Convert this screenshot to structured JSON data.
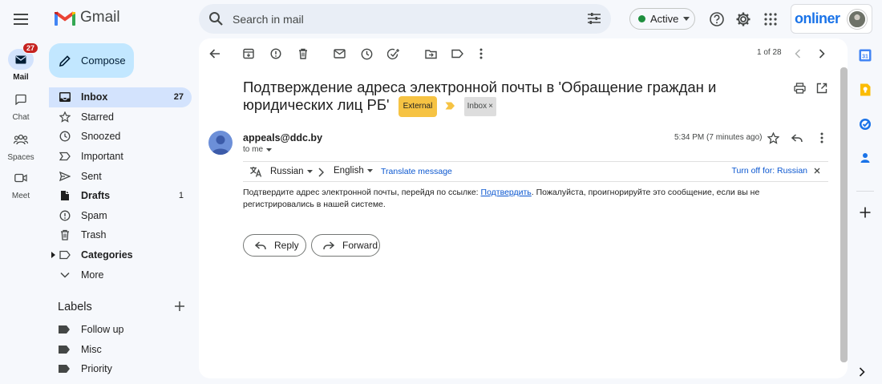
{
  "app": {
    "name": "Gmail"
  },
  "rail": {
    "items": [
      {
        "label": "Mail",
        "badge": "27",
        "icon": "mail-icon",
        "active": true
      },
      {
        "label": "Chat",
        "icon": "chat-icon"
      },
      {
        "label": "Spaces",
        "icon": "spaces-icon"
      },
      {
        "label": "Meet",
        "icon": "meet-icon"
      }
    ]
  },
  "search": {
    "placeholder": "Search in mail"
  },
  "status": {
    "label": "Active",
    "color": "#1e8e3e"
  },
  "account": {
    "brand": "onliner"
  },
  "compose": {
    "label": "Compose"
  },
  "nav": {
    "items": [
      {
        "label": "Inbox",
        "count": "27",
        "icon": "inbox-icon"
      },
      {
        "label": "Starred",
        "count": "",
        "icon": "star-icon"
      },
      {
        "label": "Snoozed",
        "count": "",
        "icon": "clock-icon"
      },
      {
        "label": "Important",
        "count": "",
        "icon": "important-icon"
      },
      {
        "label": "Sent",
        "count": "",
        "icon": "send-icon"
      },
      {
        "label": "Drafts",
        "count": "1",
        "icon": "draft-icon"
      },
      {
        "label": "Spam",
        "count": "",
        "icon": "spam-icon"
      },
      {
        "label": "Trash",
        "count": "",
        "icon": "trash-icon"
      },
      {
        "label": "Categories",
        "count": "",
        "icon": "label-icon"
      },
      {
        "label": "More",
        "count": "",
        "icon": "chevron-down-icon"
      }
    ]
  },
  "labels": {
    "header": "Labels",
    "items": [
      {
        "label": "Follow up"
      },
      {
        "label": "Misc"
      },
      {
        "label": "Priority"
      }
    ]
  },
  "toolbar": {
    "pager": "1 of 28"
  },
  "message": {
    "subject": "Подтверждение адреса электронной почты в 'Обращение граждан и юридических лиц РБ'",
    "chips": {
      "external": "External",
      "inbox": "Inbox"
    },
    "sender": "appeals@ddc.by",
    "to": "to me",
    "time": "5:34 PM (7 minutes ago)",
    "translate": {
      "from": "Russian",
      "to": "English",
      "action": "Translate message",
      "turn_off": "Turn off for: Russian"
    },
    "body": {
      "before": "Подтвердите адрес электронной почты, перейдя по ссылке: ",
      "link": "Подтвердить",
      "after": ". Пожалуйста, проигнорируйте это сообщение, если вы не регистрировались в нашей системе."
    },
    "actions": {
      "reply": "Reply",
      "forward": "Forward"
    }
  }
}
